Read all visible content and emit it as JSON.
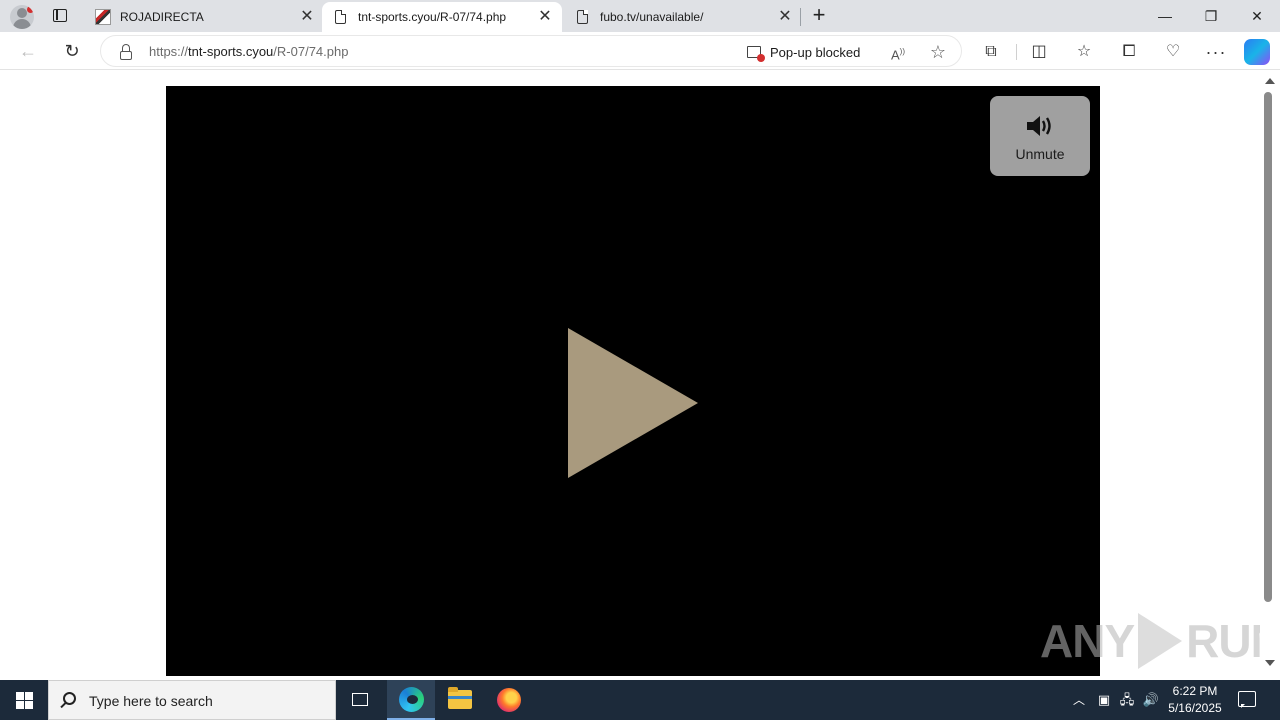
{
  "browser": {
    "tabs": [
      {
        "title": "ROJADIRECTA",
        "active": false
      },
      {
        "title": "tnt-sports.cyou/R-07/74.php",
        "active": true
      },
      {
        "title": "fubo.tv/unavailable/",
        "active": false
      }
    ],
    "address": {
      "scheme": "https://",
      "host": "tnt-sports.cyou",
      "path": "/R-07/74.php"
    },
    "popup_blocked_label": "Pop-up blocked"
  },
  "player": {
    "unmute_label": "Unmute",
    "play_color": "#a99a7e"
  },
  "watermark": {
    "left": "ANY",
    "right": "RUN"
  },
  "taskbar": {
    "search_placeholder": "Type here to search",
    "time": "6:22 PM",
    "date": "5/16/2025"
  },
  "colors": {
    "taskbar_bg": "#1c2a3a",
    "tabstrip_bg": "#dfe1e5"
  }
}
